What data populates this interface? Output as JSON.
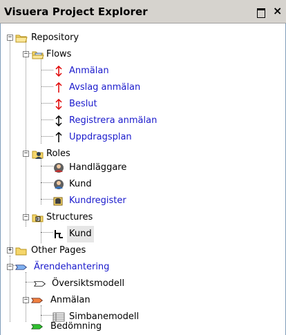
{
  "window": {
    "title": "Visuera Project Explorer",
    "maximize_glyph": "",
    "close_glyph": "×"
  },
  "tree": {
    "repository": "Repository",
    "flows": "Flows",
    "flow_items": [
      "Anmälan",
      "Avslag anmälan",
      "Beslut",
      "Registrera anmälan",
      "Uppdragsplan"
    ],
    "roles": "Roles",
    "role_items": [
      "Handläggare",
      "Kund",
      "Kundregister"
    ],
    "structures": "Structures",
    "structure_items": [
      "Kund"
    ],
    "other_pages": "Other Pages",
    "arendehantering": "Ärendehantering",
    "oversiktsmodell": "Översiktsmodell",
    "anmalan": "Anmälan",
    "simbanemodell": "Simbanemodell",
    "bedomning": "Bedömning"
  },
  "colors": {
    "link_blue": "#1a1acc",
    "arrow_red": "#e00000",
    "folder_yellow": "#f5d66b",
    "selection": "#e6e6e6"
  }
}
